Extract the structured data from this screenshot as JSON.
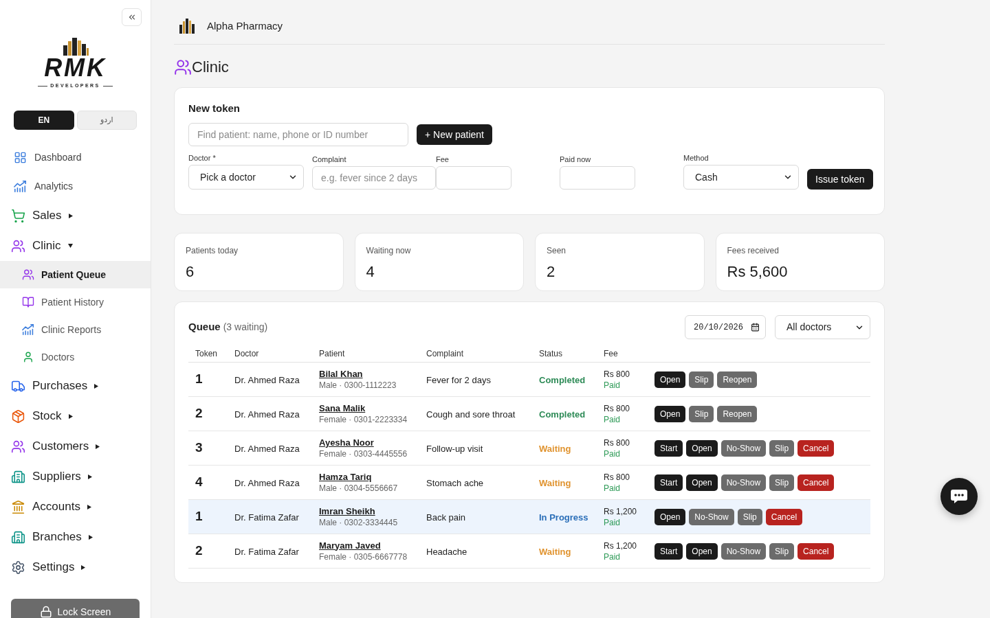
{
  "sidebar": {
    "logo": {
      "wordmark": "RMK",
      "tagline": "DEVELOPERS"
    },
    "languages": [
      {
        "label": "EN",
        "selected": true
      },
      {
        "label": "اردو",
        "selected": false
      }
    ],
    "nav": [
      {
        "label": "Dashboard",
        "kind": "link",
        "selected": false
      },
      {
        "label": "Analytics",
        "kind": "link",
        "selected": false
      },
      {
        "label": "Sales",
        "kind": "group",
        "expanded": false,
        "selected": false
      },
      {
        "label": "Clinic",
        "kind": "group",
        "expanded": true,
        "selected": false,
        "children": [
          {
            "label": "Patient Queue",
            "selected": true
          },
          {
            "label": "Patient History",
            "selected": false
          },
          {
            "label": "Clinic Reports",
            "selected": false
          },
          {
            "label": "Doctors",
            "selected": false
          }
        ]
      },
      {
        "label": "Purchases",
        "kind": "group",
        "expanded": false,
        "selected": false
      },
      {
        "label": "Stock",
        "kind": "group",
        "expanded": false,
        "selected": false
      },
      {
        "label": "Customers",
        "kind": "group",
        "expanded": false,
        "selected": false
      },
      {
        "label": "Suppliers",
        "kind": "group",
        "expanded": false,
        "selected": false
      },
      {
        "label": "Accounts",
        "kind": "group",
        "expanded": false,
        "selected": false
      },
      {
        "label": "Branches",
        "kind": "group",
        "expanded": false,
        "selected": false
      },
      {
        "label": "Settings",
        "kind": "group",
        "expanded": false,
        "selected": false
      }
    ],
    "lock_button": "Lock Screen"
  },
  "header": {
    "store_name": "Alpha Pharmacy"
  },
  "page_title": "Clinic",
  "new_token": {
    "title": "New token",
    "search": {
      "placeholder": "Find patient: name, phone or ID number"
    },
    "new_patient_button": "+ New patient",
    "fields": [
      {
        "kind": "select",
        "label": "Doctor *",
        "value": "Pick a doctor"
      },
      {
        "kind": "input",
        "label": "Complaint",
        "placeholder": "e.g. fever since 2 days"
      },
      {
        "kind": "input",
        "label": "Fee"
      },
      {
        "kind": "input",
        "label": "Paid now"
      },
      {
        "kind": "select",
        "label": "Method",
        "value": "Cash"
      }
    ],
    "issue_button": "Issue token"
  },
  "stats": [
    {
      "label": "Patients today",
      "value": "6"
    },
    {
      "label": "Waiting now",
      "value": "4"
    },
    {
      "label": "Seen",
      "value": "2"
    },
    {
      "label": "Fees received",
      "value": "Rs 5,600"
    }
  ],
  "queue": {
    "title": "Queue",
    "count": "(3 waiting)",
    "date": "20/10/2026",
    "doctor_filter": "All doctors",
    "columns": [
      "Token",
      "Doctor",
      "Patient",
      "Complaint",
      "Status",
      "Fee"
    ],
    "rows": [
      {
        "token": "1",
        "doctor": "Dr. Ahmed Raza",
        "patient": "Bilal Khan",
        "patient_details": "Male · 0300-1112223",
        "complaint": "Fever for 2 days",
        "status": {
          "label": "Completed",
          "color": "#2e8b57"
        },
        "fee": "Rs 800",
        "payment": "Paid",
        "highlighted": false,
        "actions": [
          {
            "label": "Open",
            "kind": "primary"
          },
          {
            "label": "Slip",
            "kind": "secondary"
          },
          {
            "label": "Reopen",
            "kind": "secondary"
          }
        ]
      },
      {
        "token": "2",
        "doctor": "Dr. Ahmed Raza",
        "patient": "Sana Malik",
        "patient_details": "Female · 0301-2223334",
        "complaint": "Cough and sore throat",
        "status": {
          "label": "Completed",
          "color": "#2e8b57"
        },
        "fee": "Rs 800",
        "payment": "Paid",
        "highlighted": false,
        "actions": [
          {
            "label": "Open",
            "kind": "primary"
          },
          {
            "label": "Slip",
            "kind": "secondary"
          },
          {
            "label": "Reopen",
            "kind": "secondary"
          }
        ]
      },
      {
        "token": "3",
        "doctor": "Dr. Ahmed Raza",
        "patient": "Ayesha Noor",
        "patient_details": "Female · 0303-4445556",
        "complaint": "Follow-up visit",
        "status": {
          "label": "Waiting",
          "color": "#e0932f"
        },
        "fee": "Rs 800",
        "payment": "Paid",
        "highlighted": false,
        "actions": [
          {
            "label": "Start",
            "kind": "primary"
          },
          {
            "label": "Open",
            "kind": "primary"
          },
          {
            "label": "No-Show",
            "kind": "secondary"
          },
          {
            "label": "Slip",
            "kind": "secondary"
          },
          {
            "label": "Cancel",
            "kind": "danger"
          }
        ]
      },
      {
        "token": "4",
        "doctor": "Dr. Ahmed Raza",
        "patient": "Hamza Tariq",
        "patient_details": "Male · 0304-5556667",
        "complaint": "Stomach ache",
        "status": {
          "label": "Waiting",
          "color": "#e0932f"
        },
        "fee": "Rs 800",
        "payment": "Paid",
        "highlighted": false,
        "actions": [
          {
            "label": "Start",
            "kind": "primary"
          },
          {
            "label": "Open",
            "kind": "primary"
          },
          {
            "label": "No-Show",
            "kind": "secondary"
          },
          {
            "label": "Slip",
            "kind": "secondary"
          },
          {
            "label": "Cancel",
            "kind": "danger"
          }
        ]
      },
      {
        "token": "1",
        "doctor": "Dr. Fatima Zafar",
        "patient": "Imran Sheikh",
        "patient_details": "Male · 0302-3334445",
        "complaint": "Back pain",
        "status": {
          "label": "In Progress",
          "color": "#2a6eb8"
        },
        "fee": "Rs 1,200",
        "payment": "Paid",
        "highlighted": true,
        "actions": [
          {
            "label": "Open",
            "kind": "primary"
          },
          {
            "label": "No-Show",
            "kind": "secondary"
          },
          {
            "label": "Slip",
            "kind": "secondary"
          },
          {
            "label": "Cancel",
            "kind": "danger"
          }
        ]
      },
      {
        "token": "2",
        "doctor": "Dr. Fatima Zafar",
        "patient": "Maryam Javed",
        "patient_details": "Female · 0305-6667778",
        "complaint": "Headache",
        "status": {
          "label": "Waiting",
          "color": "#e0932f"
        },
        "fee": "Rs 1,200",
        "payment": "Paid",
        "highlighted": false,
        "actions": [
          {
            "label": "Start",
            "kind": "primary"
          },
          {
            "label": "Open",
            "kind": "primary"
          },
          {
            "label": "No-Show",
            "kind": "secondary"
          },
          {
            "label": "Slip",
            "kind": "secondary"
          },
          {
            "label": "Cancel",
            "kind": "danger"
          }
        ]
      }
    ]
  }
}
